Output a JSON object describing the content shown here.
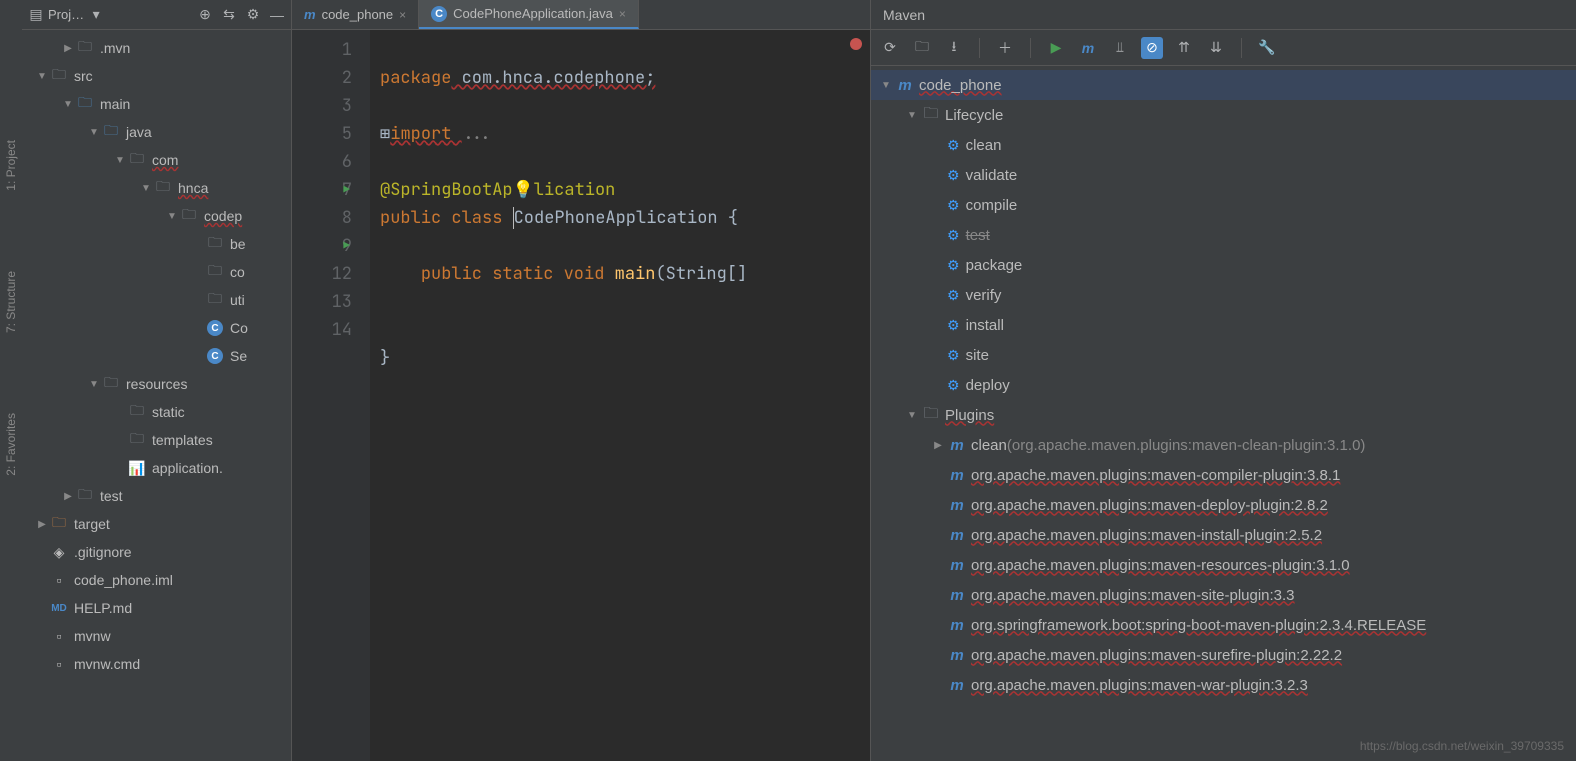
{
  "sideTabs": [
    "1: Project",
    "7: Structure",
    "2: Favorites"
  ],
  "projectHeader": {
    "title": "Proj…"
  },
  "projectTree": [
    {
      "indent": 1,
      "arrow": "▶",
      "iconColor": "folder",
      "label": ".mvn"
    },
    {
      "indent": 0,
      "arrow": "▼",
      "iconColor": "folder",
      "label": "src"
    },
    {
      "indent": 1,
      "arrow": "▼",
      "iconColor": "folder blue",
      "label": "main"
    },
    {
      "indent": 2,
      "arrow": "▼",
      "iconColor": "folder blue",
      "label": "java"
    },
    {
      "indent": 3,
      "arrow": "▼",
      "iconColor": "folder",
      "label": "com",
      "err": true
    },
    {
      "indent": 4,
      "arrow": "▼",
      "iconColor": "folder",
      "label": "hnca",
      "err": true
    },
    {
      "indent": 5,
      "arrow": "▼",
      "iconColor": "folder",
      "label": "codep",
      "err": true
    },
    {
      "indent": 6,
      "arrow": "",
      "iconColor": "folder",
      "label": "be"
    },
    {
      "indent": 6,
      "arrow": "",
      "iconColor": "folder",
      "label": "co"
    },
    {
      "indent": 6,
      "arrow": "",
      "iconColor": "folder",
      "label": "uti"
    },
    {
      "indent": 6,
      "arrow": "",
      "iconType": "class",
      "label": "Co"
    },
    {
      "indent": 6,
      "arrow": "",
      "iconType": "class",
      "label": "Se"
    },
    {
      "indent": 2,
      "arrow": "▼",
      "iconColor": "folder",
      "label": "resources"
    },
    {
      "indent": 3,
      "arrow": "",
      "iconColor": "folder",
      "label": "static"
    },
    {
      "indent": 3,
      "arrow": "",
      "iconColor": "folder",
      "label": "templates"
    },
    {
      "indent": 3,
      "arrow": "",
      "iconType": "props",
      "label": "application."
    },
    {
      "indent": 1,
      "arrow": "▶",
      "iconColor": "folder",
      "label": "test"
    },
    {
      "indent": 0,
      "arrow": "▶",
      "iconColor": "folder orange",
      "label": "target"
    },
    {
      "indent": 0,
      "arrow": "",
      "iconType": "git",
      "label": ".gitignore"
    },
    {
      "indent": 0,
      "arrow": "",
      "iconType": "iml",
      "label": "code_phone.iml"
    },
    {
      "indent": 0,
      "arrow": "",
      "iconType": "md",
      "label": "HELP.md"
    },
    {
      "indent": 0,
      "arrow": "",
      "iconType": "file",
      "label": "mvnw"
    },
    {
      "indent": 0,
      "arrow": "",
      "iconType": "file",
      "label": "mvnw.cmd"
    }
  ],
  "editorTabs": [
    {
      "icon": "m",
      "label": "code_phone",
      "active": false
    },
    {
      "icon": "c",
      "label": "CodePhoneApplication.java",
      "active": true
    }
  ],
  "gutter": {
    "lines": [
      "1",
      "2",
      "3",
      "5",
      "6",
      "7",
      "8",
      "9",
      "12",
      "13",
      "14"
    ],
    "runMarks": {
      "7": true,
      "9": true
    }
  },
  "code": {
    "l1_kw": "package",
    "l1_pkg": " com.hnca.codephone;",
    "l3_kw": "import ",
    "l3_fold": "...",
    "l6_ann": "@SpringBootAp",
    "l6_ann2": "lication",
    "l7_kw1": "public",
    "l7_kw2": " class ",
    "l7_cls": "CodePhoneApplication",
    "l7_brace": " {",
    "l9_kw": "public static void ",
    "l9_main": "main",
    "l9_args": "(String[] ",
    "l13": "}"
  },
  "maven": {
    "title": "Maven",
    "root": "code_phone",
    "lifecycle": {
      "label": "Lifecycle",
      "items": [
        "clean",
        "validate",
        "compile",
        "test",
        "package",
        "verify",
        "install",
        "site",
        "deploy"
      ]
    },
    "plugins": {
      "label": "Plugins",
      "items": [
        {
          "name": "clean",
          "detail": "(org.apache.maven.plugins:maven-clean-plugin:3.1.0)",
          "arrow": "▶"
        },
        {
          "name": "org.apache.maven.plugins:maven-compiler-plugin:3.8.1"
        },
        {
          "name": "org.apache.maven.plugins:maven-deploy-plugin:2.8.2"
        },
        {
          "name": "org.apache.maven.plugins:maven-install-plugin:2.5.2"
        },
        {
          "name": "org.apache.maven.plugins:maven-resources-plugin:3.1.0"
        },
        {
          "name": "org.apache.maven.plugins:maven-site-plugin:3.3"
        },
        {
          "name": "org.springframework.boot:spring-boot-maven-plugin:2.3.4.RELEASE"
        },
        {
          "name": "org.apache.maven.plugins:maven-surefire-plugin:2.22.2"
        },
        {
          "name": "org.apache.maven.plugins:maven-war-plugin:3.2.3"
        }
      ]
    }
  },
  "watermark": "https://blog.csdn.net/weixin_39709335"
}
